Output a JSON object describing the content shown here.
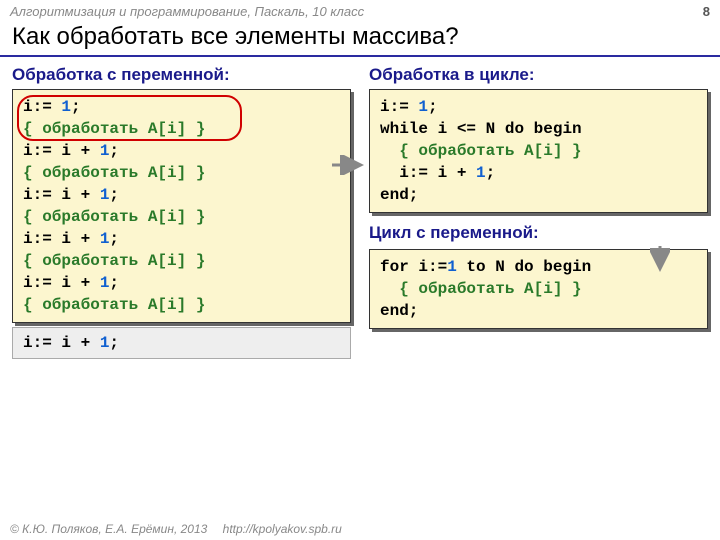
{
  "header": {
    "course": "Алгоритмизация и программирование, Паскаль, 10 класс",
    "page": "8"
  },
  "title": "Как обработать все элементы массива?",
  "left": {
    "heading": "Обработка с переменной:",
    "code": {
      "l1a": "i:= ",
      "l1b": "1",
      "l1c": ";",
      "l2": "{ обработать A[i] }",
      "l3a": "i:= i + ",
      "l3b": "1",
      "l3c": ";",
      "l4": "{ обработать A[i] }",
      "l5a": "i:= i + ",
      "l5b": "1",
      "l5c": ";",
      "l6": "{ обработать A[i] }",
      "l7a": "i:= i + ",
      "l7b": "1",
      "l7c": ";",
      "l8": "{ обработать A[i] }",
      "l9a": "i:= i + ",
      "l9b": "1",
      "l9c": ";",
      "l10": "{ обработать A[i] }"
    },
    "extra": {
      "a": "i:= i + ",
      "b": "1",
      "c": ";"
    }
  },
  "right": {
    "heading1": "Обработка в цикле:",
    "code1": {
      "l1a": "i:= ",
      "l1b": "1",
      "l1c": ";",
      "l2a": "while",
      "l2b": " i ",
      "l2c": "<=",
      "l2d": " N ",
      "l2e": "do begin",
      "l3": "  { обработать A[i] }",
      "l4a": "  i:= i + ",
      "l4b": "1",
      "l4c": ";",
      "l5": "end;"
    },
    "heading2": "Цикл с переменной:",
    "code2": {
      "l1a": "for",
      "l1b": " i:=",
      "l1c": "1",
      "l1d": " to",
      "l1e": " N ",
      "l1f": "do begin",
      "l2": "  { обработать A[i] }",
      "l3": "end;"
    }
  },
  "footer": {
    "copyright": "© К.Ю. Поляков, Е.А. Ерёмин, 2013",
    "url": "http://kpolyakov.spb.ru"
  }
}
